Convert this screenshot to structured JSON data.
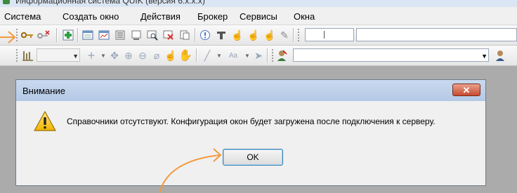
{
  "window": {
    "title": "Информационная система QUIK (версия 6.x.x.x)"
  },
  "menu": [
    "Система",
    "Создать окно",
    "Действия",
    "Брокер",
    "Сервисы",
    "Окна"
  ],
  "toolbar1": {
    "icons": [
      "connect-key-icon",
      "disconnect-key-icon",
      "add-icon",
      "table-icon",
      "chart-icon",
      "list-icon",
      "order-icon",
      "search-icon",
      "filter-icon",
      "copy-icon",
      "alert-icon",
      "text-icon",
      "hand-icon",
      "hand2-icon",
      "hand3-icon",
      "pen-icon"
    ]
  },
  "toolbar2": {
    "icons": [
      "chart-bars-icon",
      "plus-icon",
      "move-icon",
      "zoom-in-icon",
      "zoom-out-icon",
      "eraser-icon",
      "hand-icon",
      "hand-open-icon",
      "line-icon",
      "font-icon",
      "arrow-icon",
      "user-icon",
      "user-search-icon"
    ],
    "font_label": "Aa"
  },
  "dialog": {
    "title": "Внимание",
    "close_label": "✕",
    "message": "Справочники отсутствуют. Конфигурация окон будет загружена после подключения к серверу.",
    "ok_label": "OK"
  },
  "colors": {
    "arrow": "#f29a3f",
    "dialog_title_bg": "#bcd0ea"
  }
}
